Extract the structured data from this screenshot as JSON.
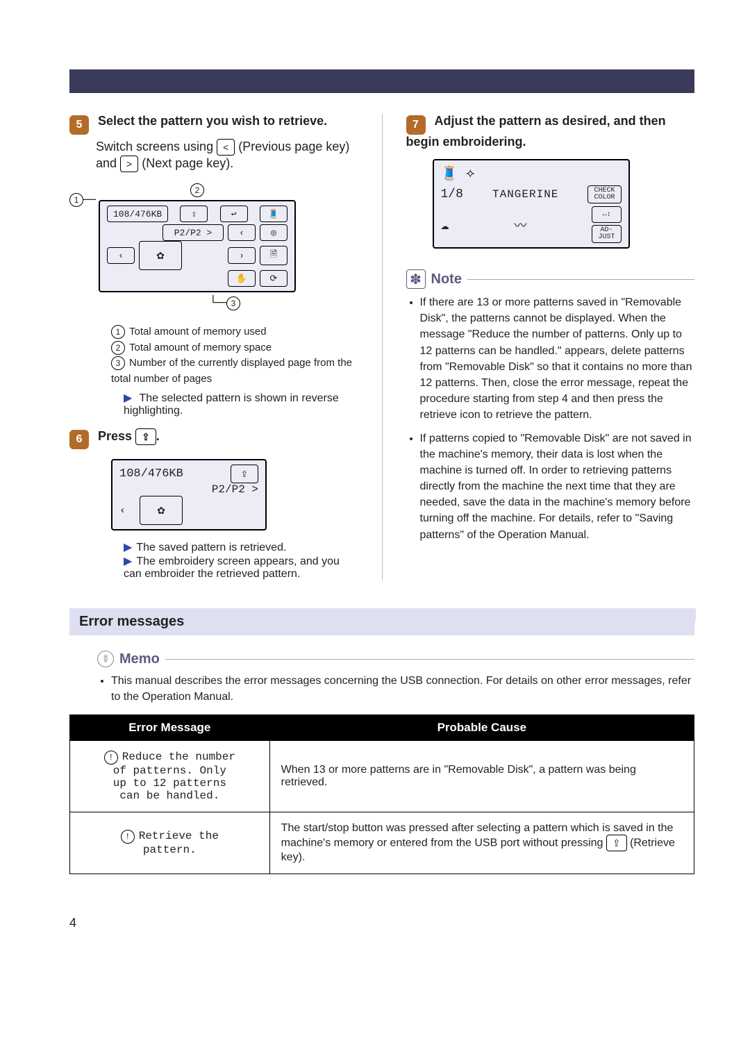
{
  "step5": {
    "title": "Select the pattern you wish to retrieve.",
    "body_prefix": "Switch screens using ",
    "prev_key_desc": "(Previous page key)",
    "body_mid": "and ",
    "next_key_desc": "(Next page key).",
    "lcd": {
      "memtext": "108/476KB",
      "page": "P2/P2 >"
    },
    "legend": {
      "l1": "Total amount of memory used",
      "l2": "Total amount of memory space",
      "l3": "Number of the currently displayed page from the total number of pages"
    },
    "sub": "The selected pattern is shown in reverse highlighting."
  },
  "step6": {
    "title_prefix": "Press ",
    "title_suffix": ".",
    "lcd": {
      "memtext": "108/476KB",
      "page": "P2/P2 >"
    },
    "sub1": "The saved pattern is retrieved.",
    "sub2": "The embroidery screen appears, and you can embroider the retrieved pattern."
  },
  "step7": {
    "title": "Adjust the pattern as desired, and then begin embroidering.",
    "lcd": {
      "frac": "1/8",
      "name": "TANGERINE",
      "btn_check": "CHECK COLOR",
      "btn_adjust": "AD-JUST"
    }
  },
  "note": {
    "heading": "Note",
    "items": [
      "If there are 13 or more patterns saved in \"Removable Disk\", the patterns cannot be displayed. When the message \"Reduce the number of patterns. Only up to 12 patterns can be handled.\" appears, delete patterns from \"Removable Disk\" so that it contains no more than 12 patterns. Then, close the error message, repeat the procedure starting from step 4 and then press the retrieve icon to retrieve the pattern.",
      "If patterns copied to \"Removable Disk\" are not saved in the machine's memory, their data is lost when the machine is turned off. In order to retrieving patterns directly from the machine the next time that they are needed, save the data in the machine's memory before turning off the machine. For details, refer to \"Saving patterns\" of the Operation Manual."
    ]
  },
  "error_section": {
    "heading": "Error messages",
    "memo_heading": "Memo",
    "memo_text": "This manual describes the error messages concerning the USB connection. For details on other error messages, refer to the Operation Manual.",
    "th_msg": "Error Message",
    "th_cause": "Probable Cause",
    "rows": [
      {
        "msg_lines": [
          "Reduce the number",
          "of patterns. Only",
          "up to 12 patterns",
          "can be handled."
        ],
        "cause": "When 13 or more patterns are in \"Removable Disk\", a pattern was being retrieved."
      },
      {
        "msg_lines": [
          "Retrieve the",
          "pattern."
        ],
        "cause_prefix": "The start/stop button was pressed after selecting a pattern which is saved in the machine's memory or entered from the USB port without pressing ",
        "cause_key_desc": "(Retrieve key)."
      }
    ]
  },
  "page_number": "4",
  "glyphs": {
    "prev": "<",
    "next": ">",
    "arrow": "▶"
  }
}
